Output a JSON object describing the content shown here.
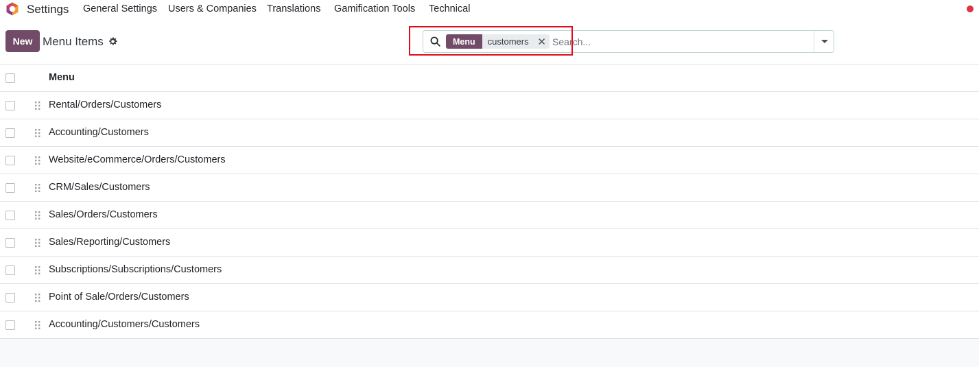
{
  "navbar": {
    "app_name": "Settings",
    "items": [
      {
        "label": "General Settings"
      },
      {
        "label": "Users & Companies"
      },
      {
        "label": "Translations"
      },
      {
        "label": "Gamification Tools"
      },
      {
        "label": "Technical"
      }
    ],
    "logo_icon": "odoo-logo-icon",
    "notification_color": "#dc3545"
  },
  "control_panel": {
    "new_label": "New",
    "title": "Menu Items",
    "settings_icon": "gear-icon",
    "accent_color": "#714b67"
  },
  "search": {
    "icon": "search-icon",
    "facet_label": "Menu",
    "facet_value": "customers",
    "facet_remove_icon": "close-icon",
    "placeholder": "Search...",
    "value": "",
    "toggle_icon": "caret-down-icon"
  },
  "list": {
    "column_header": "Menu",
    "rows": [
      {
        "name": "Rental/Orders/Customers"
      },
      {
        "name": "Accounting/Customers"
      },
      {
        "name": "Website/eCommerce/Orders/Customers"
      },
      {
        "name": "CRM/Sales/Customers"
      },
      {
        "name": "Sales/Orders/Customers"
      },
      {
        "name": "Sales/Reporting/Customers"
      },
      {
        "name": "Subscriptions/Subscriptions/Customers"
      },
      {
        "name": "Point of Sale/Orders/Customers"
      },
      {
        "name": "Accounting/Customers/Customers"
      }
    ]
  }
}
